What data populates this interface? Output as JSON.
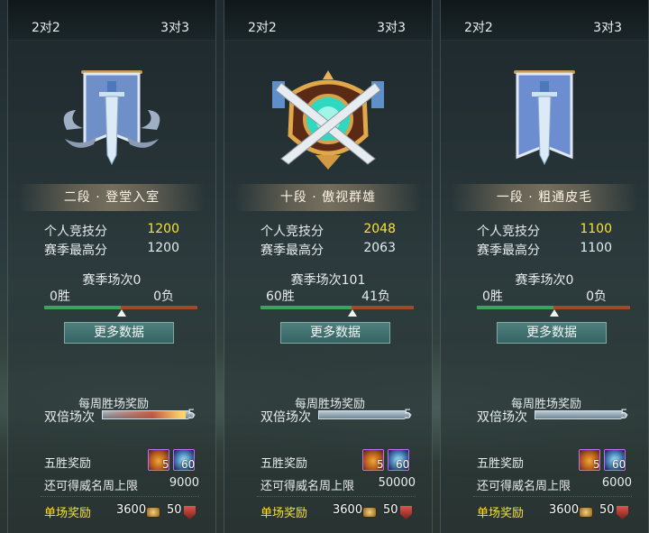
{
  "tabs": {
    "mode_2v2": "2对2",
    "mode_3v3": "3对3"
  },
  "labels": {
    "personal_score": "个人竞技分",
    "season_high": "赛季最高分",
    "more_data": "更多数据",
    "weekly_reward": "每周胜场奖励",
    "double_matches": "双倍场次",
    "five_win_reward": "五胜奖励",
    "weekly_cap": "还可得威名周上限",
    "single_match_reward": "单场奖励"
  },
  "cards": [
    {
      "rank": "二段 · 登堂入室",
      "score": "1200",
      "season_high": "1200",
      "season_games": "赛季场次0",
      "wins": "0胜",
      "losses": "0负",
      "win_ratio": 0.5,
      "double_count": "5",
      "double_progress": 0.9,
      "chest_count": "5",
      "staff_count": "60",
      "weekly_cap": "9000",
      "coin_reward": "3600",
      "shield_reward": "50",
      "emblem": "silver-banner-sword-icon"
    },
    {
      "rank": "十段 · 傲视群雄",
      "score": "2048",
      "season_high": "2063",
      "season_games": "赛季场次101",
      "wins": "60胜",
      "losses": "41负",
      "win_ratio": 0.594,
      "double_count": "5",
      "double_progress": 0.0,
      "chest_count": "5",
      "staff_count": "60",
      "weekly_cap": "50000",
      "coin_reward": "3600",
      "shield_reward": "50",
      "emblem": "golden-crossed-swords-icon"
    },
    {
      "rank": "一段 · 粗通皮毛",
      "score": "1100",
      "season_high": "1100",
      "season_games": "赛季场次0",
      "wins": "0胜",
      "losses": "0负",
      "win_ratio": 0.5,
      "double_count": "5",
      "double_progress": 0.0,
      "chest_count": "5",
      "staff_count": "60",
      "weekly_cap": "6000",
      "coin_reward": "3600",
      "shield_reward": "50",
      "emblem": "blue-banner-sword-icon"
    }
  ],
  "colors": {
    "highlight": "#f7e23c",
    "win_bar": "#3fa063",
    "loss_bar": "#a04a2c",
    "gold_label": "#f3e23a"
  }
}
